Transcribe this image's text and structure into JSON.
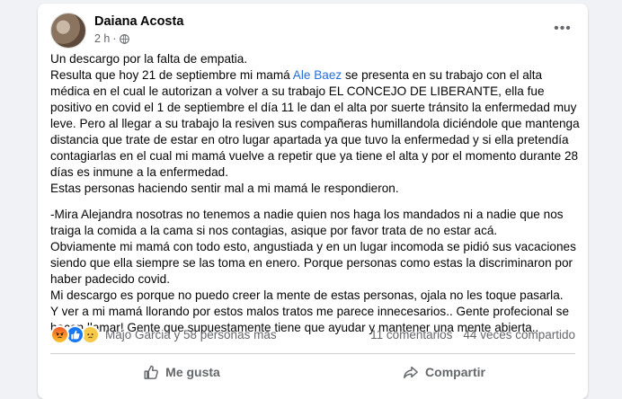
{
  "post": {
    "author": "Daiana Acosta",
    "time": "2 h",
    "separator": "·",
    "more_label": "•••",
    "paragraphs": [
      {
        "before": "Un descargo por la falta de empatia.\nResulta que hoy 21 de septiembre mi mamá ",
        "mention": "Ale Baez",
        "after": " se presenta en su trabajo con el alta médica en el cual le autorizan a volver a su trabajo EL CONCEJO DE LIBERANTE, ella fue positivo en covid el 1 de septiembre el día 11 le dan el alta por suerte tránsito la enfermedad muy leve. Pero al llegar a su trabajo la resiven sus compañeras humillandola diciéndole que mantenga distancia que trate de estar en otro lugar apartada ya que tuvo la enfermedad y si ella pretendía contagiarlas en el cual mi mamá vuelve a repetir que ya tiene el alta y por el momento durante 28 días es inmune a la enfermedad.\nEstas personas haciendo sentir mal a mi mamá le respondieron."
      },
      {
        "text": "-Mira Alejandra nosotras no tenemos a nadie quien nos haga los mandados ni a nadie que nos traiga la comida a la cama si nos contagias, asique por favor trata de no estar acá.\nObviamente mi mamá con todo esto, angustiada y en un lugar incomoda se pidió sus vacaciones siendo que ella siempre se las toma en enero. Porque personas como estas la discriminaron por haber padecido covid.\nMi descargo es porque no puedo creer la mente de estas personas, ojala no les toque pasarla.\nY ver a mi mamá llorando por estos malos tratos me parece innecesarios.. Gente profecional se hacen llamar! Gente que supuestamente tiene que ayudar y mantener una mente abierta.."
      }
    ]
  },
  "stats": {
    "reaction_icons": [
      "angry-icon",
      "like-icon",
      "sad-icon"
    ],
    "reactors": "Majo Garcia y 58 personas más",
    "comments": "11 comentarios",
    "shares": "44 veces compartido"
  },
  "actions": {
    "like_label": "Me gusta",
    "share_label": "Compartir"
  },
  "colors": {
    "background": "#f0f2f5",
    "mention": "#216fdb",
    "secondary_text": "#65676b",
    "like_blue": "#1877f2"
  }
}
